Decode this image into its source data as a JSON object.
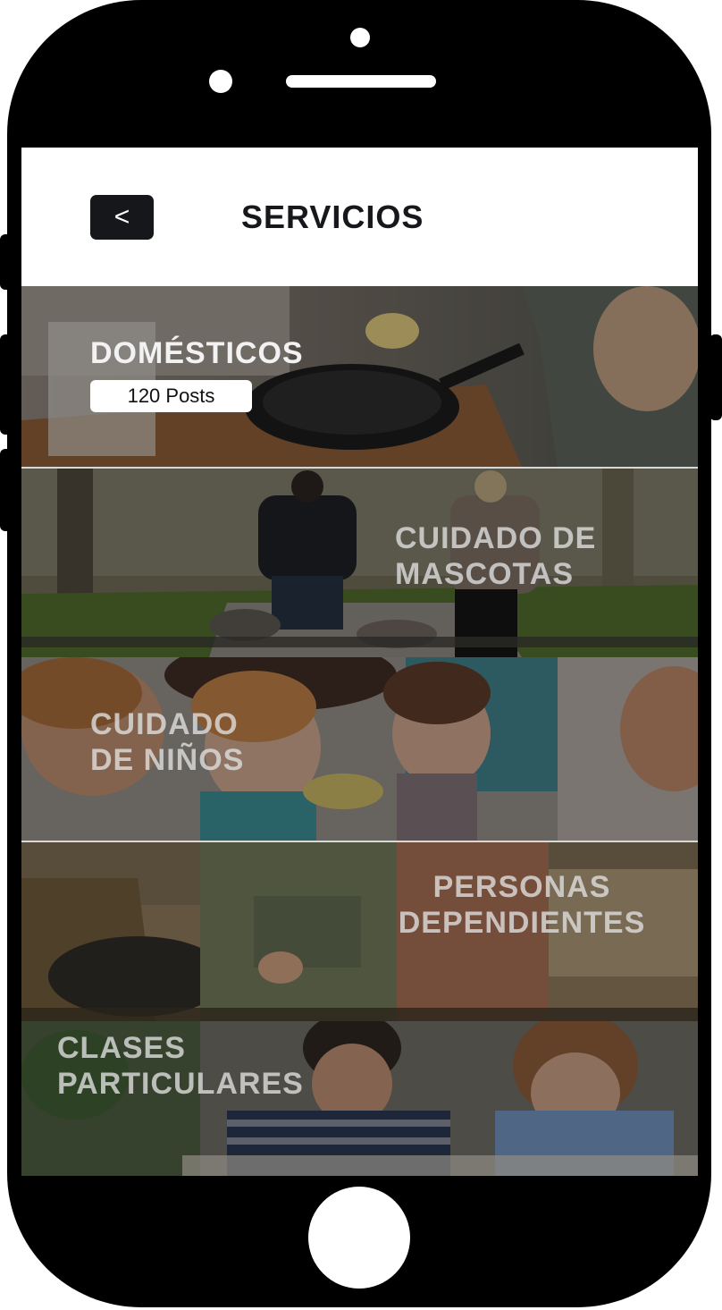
{
  "header": {
    "back_icon": "chevron-left-icon",
    "back_glyph": "<",
    "title": "SERVICIOS"
  },
  "categories": [
    {
      "label": "DOMÉSTICOS",
      "posts": "120 Posts",
      "photo": "kitchen-cooking-photo"
    },
    {
      "label": "CUIDADO DE\nMASCOTAS",
      "photo": "dog-walkers-photo"
    },
    {
      "label": "CUIDADO\nDE NIÑOS",
      "photo": "children-eating-photo"
    },
    {
      "label": "PERSONAS\nDEPENDIENTES",
      "photo": "caregiver-elderly-photo"
    },
    {
      "label": "CLASES\nPARTICULARES",
      "photo": "tutoring-photo"
    }
  ],
  "colors": {
    "frame": "#000000",
    "back_button": "#15171b",
    "title": "#16181c"
  }
}
